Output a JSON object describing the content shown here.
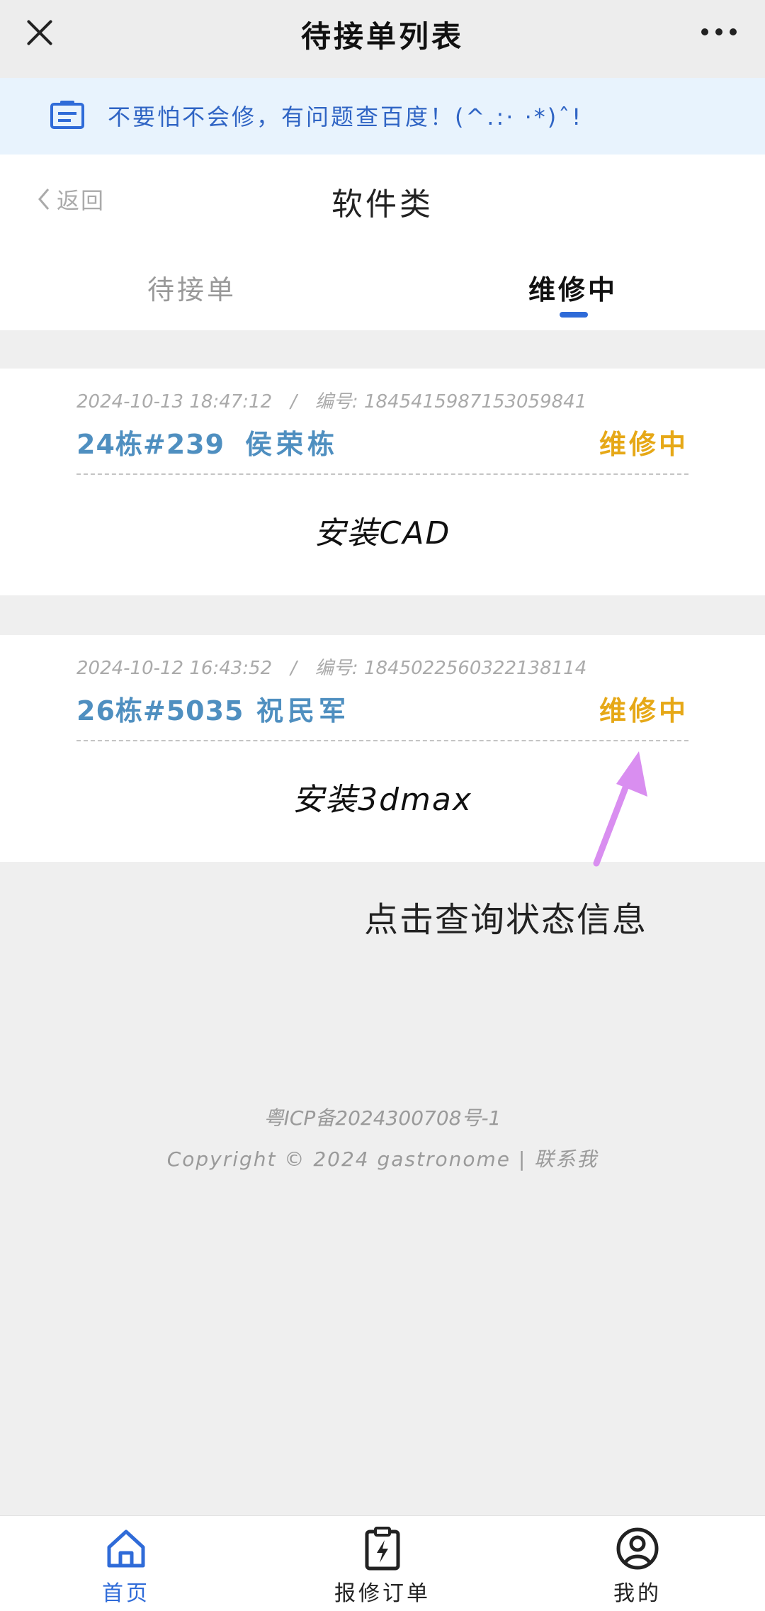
{
  "window": {
    "title": "待接单列表"
  },
  "notice": {
    "text": "不要怕不会修，有问题查百度！(^.:·  ·*)ˆ!"
  },
  "header": {
    "back_label": "返回",
    "title": "软件类"
  },
  "tabs": [
    {
      "label": "待接单",
      "active": false
    },
    {
      "label": "维修中",
      "active": true
    }
  ],
  "orders": [
    {
      "datetime": "2024-10-13 18:47:12",
      "separator": "/",
      "number_label": "编号:",
      "number": "1845415987153059841",
      "location": "24栋#239",
      "name": "侯荣栋",
      "status": "维修中",
      "task": "安装CAD"
    },
    {
      "datetime": "2024-10-12 16:43:52",
      "separator": "/",
      "number_label": "编号:",
      "number": "1845022560322138114",
      "location": "26栋#5035",
      "name": "祝民军",
      "status": "维修中",
      "task": "安装3dmax"
    }
  ],
  "annotation": {
    "text": "点击查询状态信息"
  },
  "footer": {
    "icp": "粤ICP备2024300708号-1",
    "copyright": "Copyright © 2024 gastronome",
    "divider": "|",
    "contact": "联系我"
  },
  "bottom_nav": [
    {
      "label": "首页",
      "icon": "home-icon",
      "active": true
    },
    {
      "label": "报修订单",
      "icon": "clipboard-bolt-icon",
      "active": false
    },
    {
      "label": "我的",
      "icon": "user-circle-icon",
      "active": false
    }
  ],
  "colors": {
    "accent": "#2f6bd8",
    "notice_text": "#2f64c4",
    "card_link": "#4f8fc0",
    "status": "#e6a817",
    "annotation_arrow": "#d98ef0"
  }
}
